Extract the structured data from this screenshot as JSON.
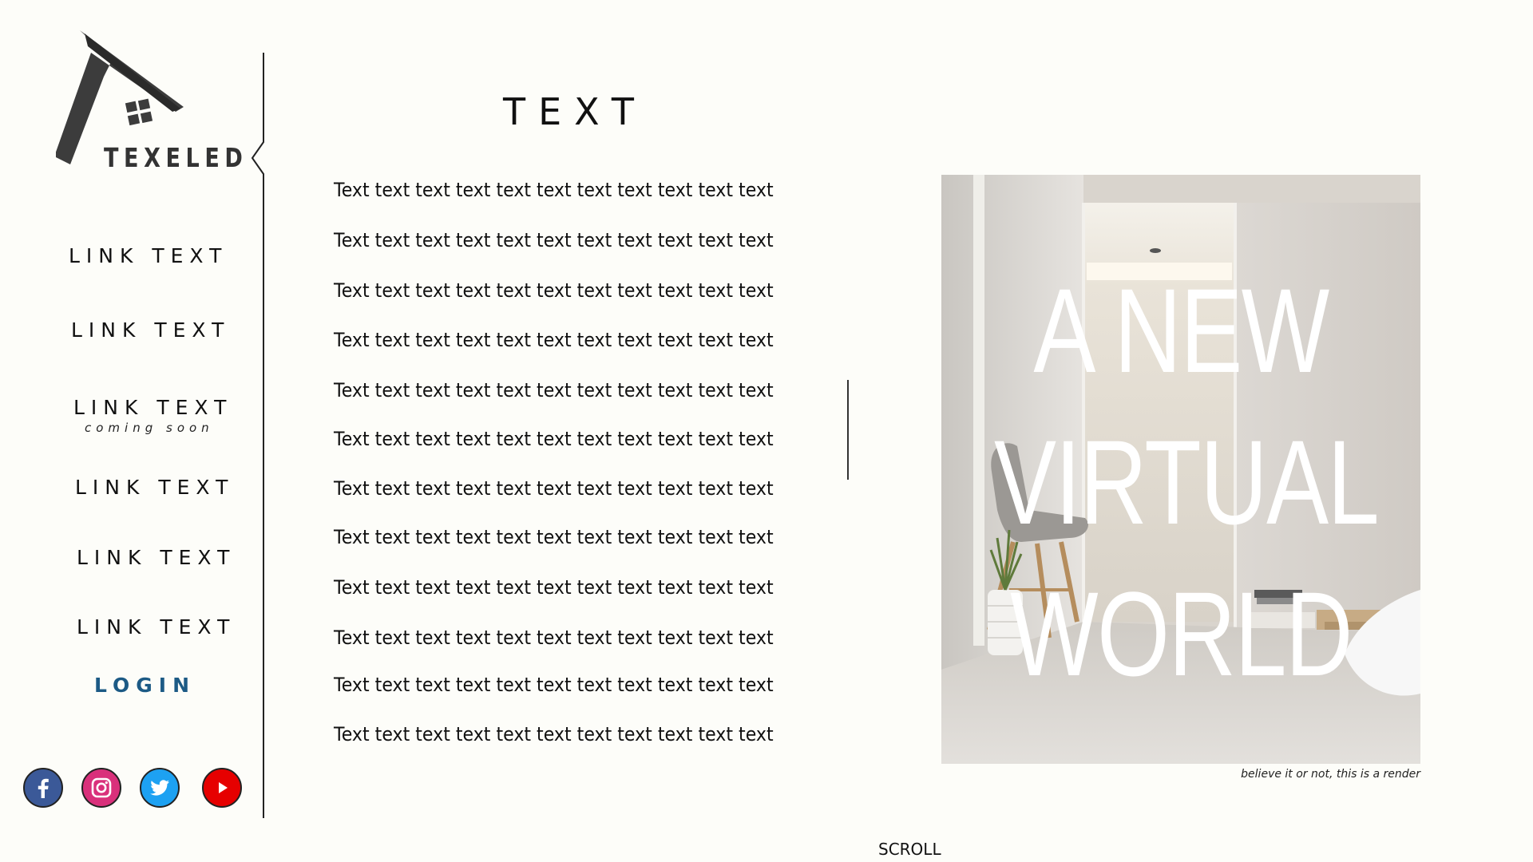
{
  "brand": {
    "name": "TEXELED"
  },
  "sidebar": {
    "links": [
      {
        "label": "LINK TEXT"
      },
      {
        "label": "LINK TEXT"
      },
      {
        "label": "LINK TEXT",
        "sublabel": "coming soon"
      },
      {
        "label": "LINK TEXT"
      },
      {
        "label": "LINK TEXT"
      },
      {
        "label": "LINK TEXT"
      }
    ],
    "login_label": "LOGIN",
    "social": [
      {
        "icon": "facebook-icon",
        "color": "#3b5998"
      },
      {
        "icon": "instagram-icon",
        "color": "#d9307b"
      },
      {
        "icon": "twitter-icon",
        "color": "#1da1f2"
      },
      {
        "icon": "youtube-icon",
        "color": "#e60000"
      }
    ]
  },
  "main": {
    "title": "TEXT",
    "lines": [
      "Text text text text text text text text text text text",
      "Text text text text text text text text text text text",
      "Text text text text text text text text text text text",
      "Text text text text text text text text text text text",
      "Text text text text text text text text text text text",
      "Text text text text text text text text text text text",
      "Text text text text text text text text text text text",
      "Text text text text text text text text text text text",
      "Text text text text text text text text text text text",
      "Text text text text text text text text text text text",
      "Text text text text text text text text text text text",
      "Text text text text text text text text text text text"
    ]
  },
  "hero": {
    "headline": [
      "A NEW",
      "VIRTUAL",
      "WORLD"
    ],
    "caption": "believe it or not, this is a render"
  },
  "footer": {
    "scroll_label": "SCROLL"
  },
  "colors": {
    "background": "#fdfdf9",
    "login": "#1c5a85",
    "text": "#111111"
  }
}
